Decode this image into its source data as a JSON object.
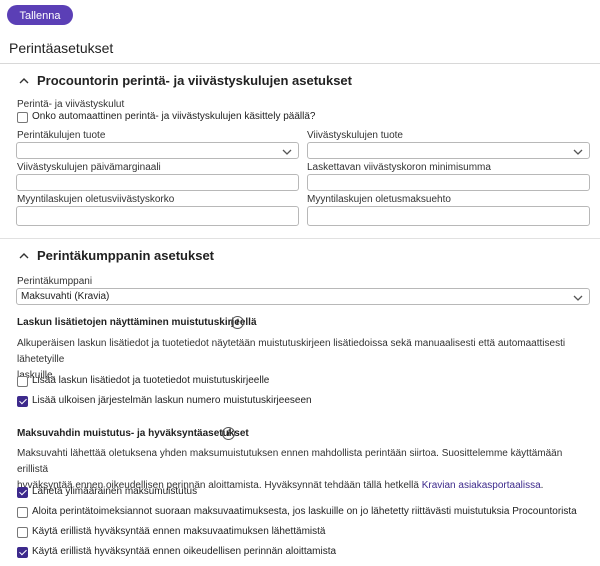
{
  "toolbar": {
    "save_label": "Tallenna"
  },
  "page": {
    "title": "Perintäasetukset"
  },
  "procountor": {
    "title": "Procountorin perintä- ja viivästyskulujen asetukset",
    "fees_label": "Perintä- ja viivästyskulut",
    "auto_checkbox": {
      "label": "Onko automaattinen perintä- ja viivästyskulujen käsittely päällä?",
      "checked": false
    },
    "collection_fee_product": {
      "label": "Perintäkulujen tuote",
      "value": ""
    },
    "late_fee_product": {
      "label": "Viivästyskulujen tuote",
      "value": ""
    },
    "late_fee_days_margin": {
      "label": "Viivästyskulujen päivämarginaali",
      "value": ""
    },
    "late_interest_minimum": {
      "label": "Laskettavan viivästyskoron minimisumma",
      "value": ""
    },
    "default_late_interest": {
      "label": "Myyntilaskujen oletusviivästyskorko",
      "value": ""
    },
    "default_payment_term": {
      "label": "Myyntilaskujen oletusmaksuehto",
      "value": ""
    }
  },
  "partner": {
    "title": "Perintäkumppanin asetukset",
    "partner_label": "Perintäkumppani",
    "partner_value": "Maksuvahti (Kravia)",
    "invoice_info": {
      "heading": "Laskun lisätietojen näyttäminen muistutuskirjeellä",
      "text_line1": "Alkuperäisen laskun lisätiedot ja tuotetiedot näytetään muistutuskirjeen lisätiedoissa sekä manuaalisesti että automaattisesti lähetetyille",
      "text_line2": "laskuille.",
      "options": [
        {
          "label": "Lisää laskun lisätiedot ja tuotetiedot muistutuskirjeelle",
          "checked": false
        },
        {
          "label": "Lisää ulkoisen järjestelmän laskun numero muistutuskirjeeseen",
          "checked": true
        }
      ]
    },
    "reminder": {
      "heading": "Maksuvahdin muistutus- ja hyväksyntäasetukset",
      "text_line1": "Maksuvahti lähettää oletuksena yhden maksumuistutuksen ennen mahdollista perintään siirtoa. Suosittelemme käyttämään erillistä",
      "text_line2_a": "hyväksyntää ennen oikeudellisen perinnän aloittamista. Hyväksynnät tehdään tällä hetkellä ",
      "text_line2_link": "Kravian asiakasportaalissa",
      "text_line2_b": ".",
      "options": [
        {
          "label": "Lähetä ylimääräinen maksumuistutus",
          "checked": true
        },
        {
          "label": "Aloita perintätoimeksiannot suoraan maksuvaatimuksesta, jos laskuille on jo lähetetty riittävästi muistutuksia Procountorista",
          "checked": false
        },
        {
          "label": "Käytä erillistä hyväksyntää ennen maksuvaatimuksen lähettämistä",
          "checked": false
        },
        {
          "label": "Käytä erillistä hyväksyntää ennen oikeudellisen perinnän aloittamista",
          "checked": true
        }
      ]
    }
  },
  "colors": {
    "accent": "#5b3fb6",
    "checkbox_checked": "#3d2a8c",
    "link": "#3d2a8c"
  }
}
